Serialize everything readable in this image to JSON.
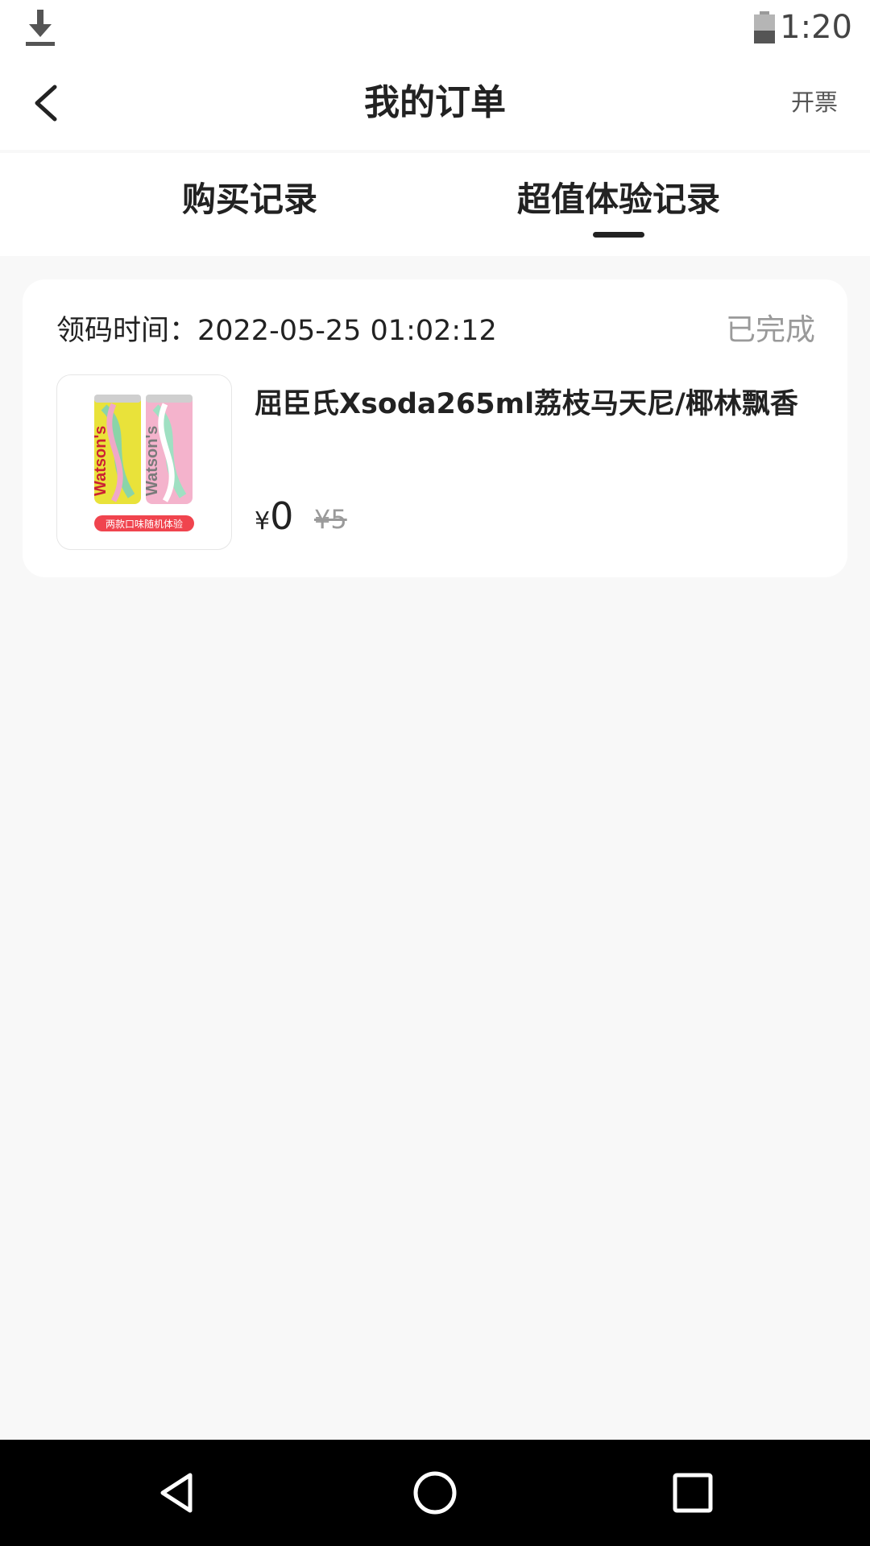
{
  "status_bar": {
    "time": "1:20",
    "icons": [
      "download-icon",
      "battery-icon"
    ]
  },
  "header": {
    "title": "我的订单",
    "right_action": "开票",
    "back_icon": "chevron-left-icon"
  },
  "tabs": [
    {
      "label": "购买记录",
      "active": false
    },
    {
      "label": "超值体验记录",
      "active": true
    }
  ],
  "orders": [
    {
      "time_label": "领码时间：2022-05-25 01:02:12",
      "status": "已完成",
      "product_name": "屈臣氏Xsoda265ml荔枝马天尼/椰林飘香",
      "image_caption": "两款口味随机体验",
      "image_brand": "Watson's",
      "currency": "¥",
      "price": "0",
      "original_price": "¥5"
    }
  ],
  "nav_bar": {
    "icons": [
      "nav-back-icon",
      "nav-home-icon",
      "nav-recent-icon"
    ]
  },
  "colors": {
    "background": "#f8f8f8",
    "card": "#ffffff",
    "muted_text": "#9a9a9a",
    "primary_text": "#222222"
  }
}
